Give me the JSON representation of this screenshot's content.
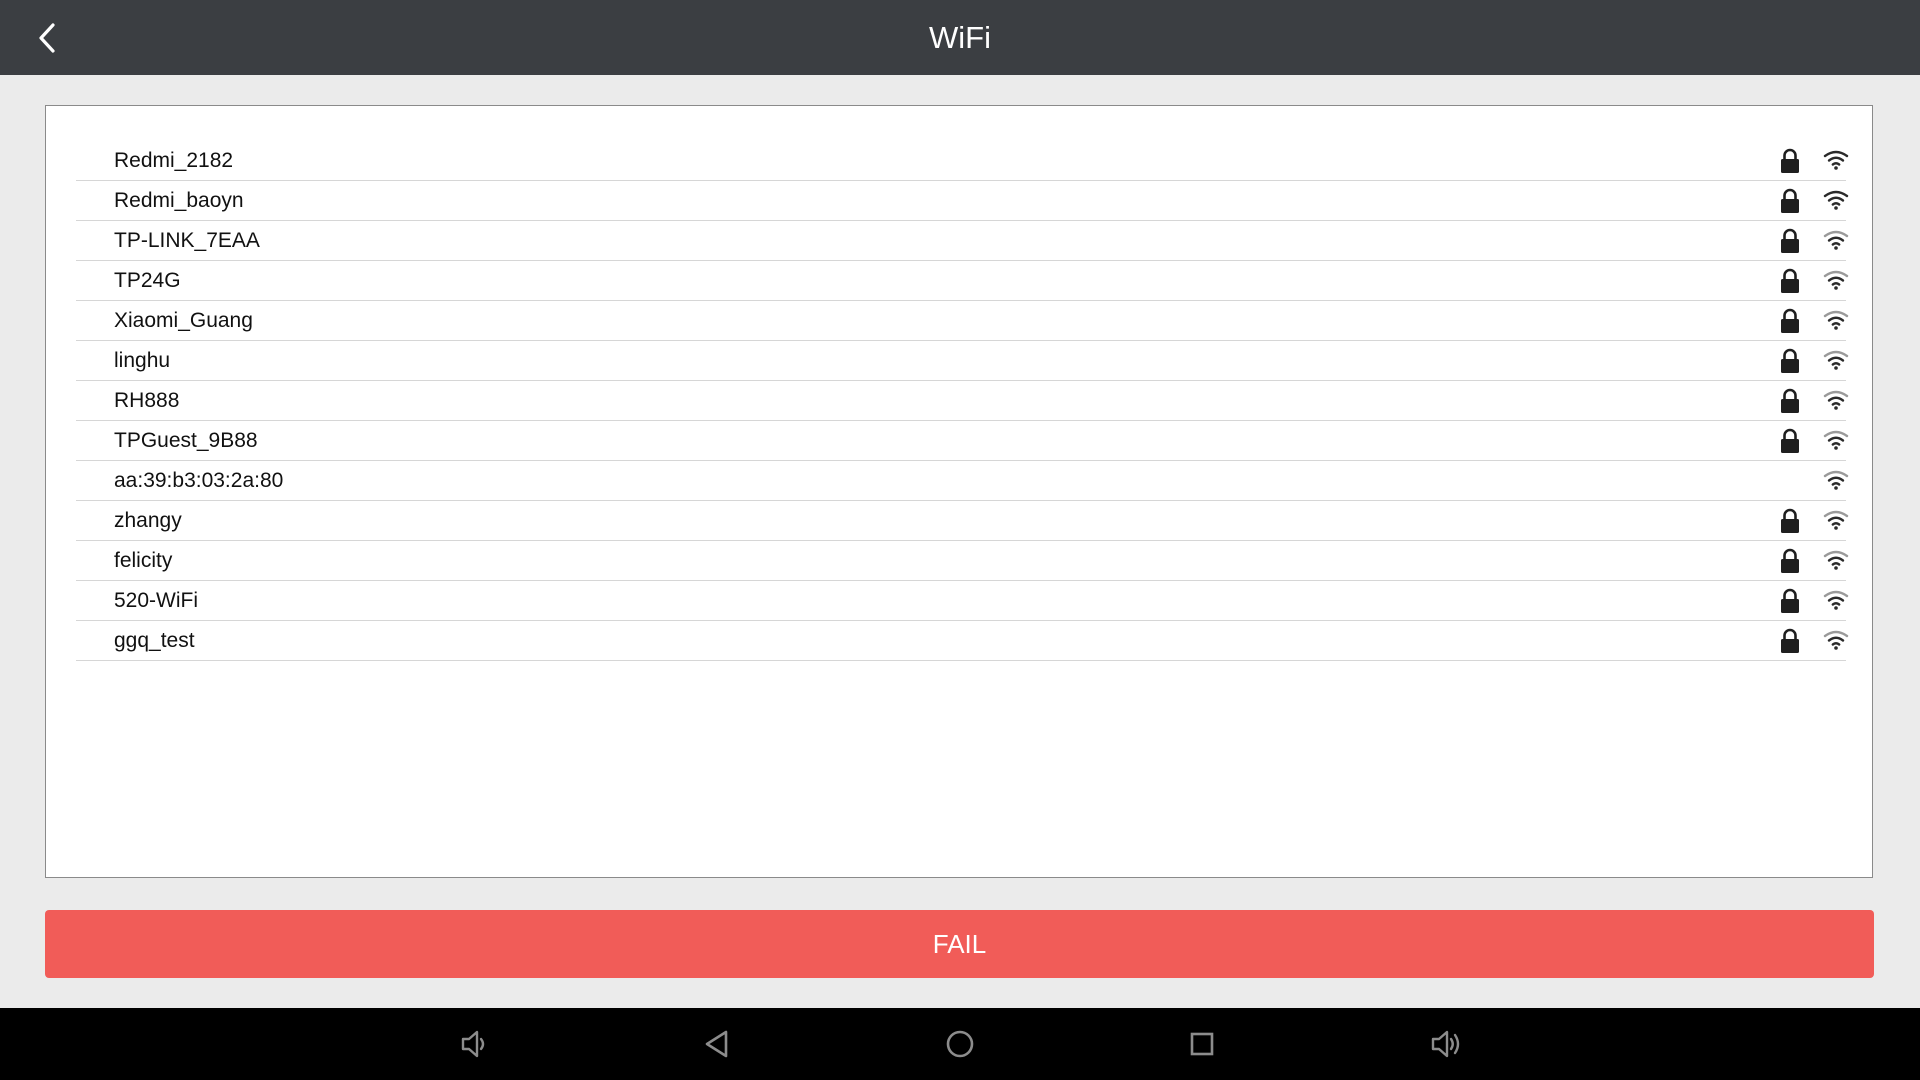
{
  "header": {
    "title": "WiFi",
    "back_icon": "chevron-left-icon"
  },
  "networks": [
    {
      "ssid": "Redmi_2182",
      "secured": true,
      "signal": "full"
    },
    {
      "ssid": "Redmi_baoyn",
      "secured": true,
      "signal": "full"
    },
    {
      "ssid": "TP-LINK_7EAA",
      "secured": true,
      "signal": "medium"
    },
    {
      "ssid": "TP24G",
      "secured": true,
      "signal": "medium"
    },
    {
      "ssid": "Xiaomi_Guang",
      "secured": true,
      "signal": "medium"
    },
    {
      "ssid": "linghu",
      "secured": true,
      "signal": "medium"
    },
    {
      "ssid": "RH888",
      "secured": true,
      "signal": "medium"
    },
    {
      "ssid": "TPGuest_9B88",
      "secured": true,
      "signal": "medium"
    },
    {
      "ssid": "aa:39:b3:03:2a:80",
      "secured": false,
      "signal": "medium"
    },
    {
      "ssid": "zhangy",
      "secured": true,
      "signal": "medium"
    },
    {
      "ssid": "felicity",
      "secured": true,
      "signal": "medium"
    },
    {
      "ssid": "520-WiFi",
      "secured": true,
      "signal": "medium"
    },
    {
      "ssid": "ggq_test",
      "secured": true,
      "signal": "medium"
    }
  ],
  "actions": {
    "fail_label": "FAIL"
  },
  "navbar": {
    "buttons": [
      "volume-down-icon",
      "back-triangle-icon",
      "home-circle-icon",
      "recents-square-icon",
      "volume-up-icon"
    ]
  },
  "colors": {
    "topbar": "#3b3e42",
    "fail": "#f15c58",
    "background": "#ebebeb"
  }
}
